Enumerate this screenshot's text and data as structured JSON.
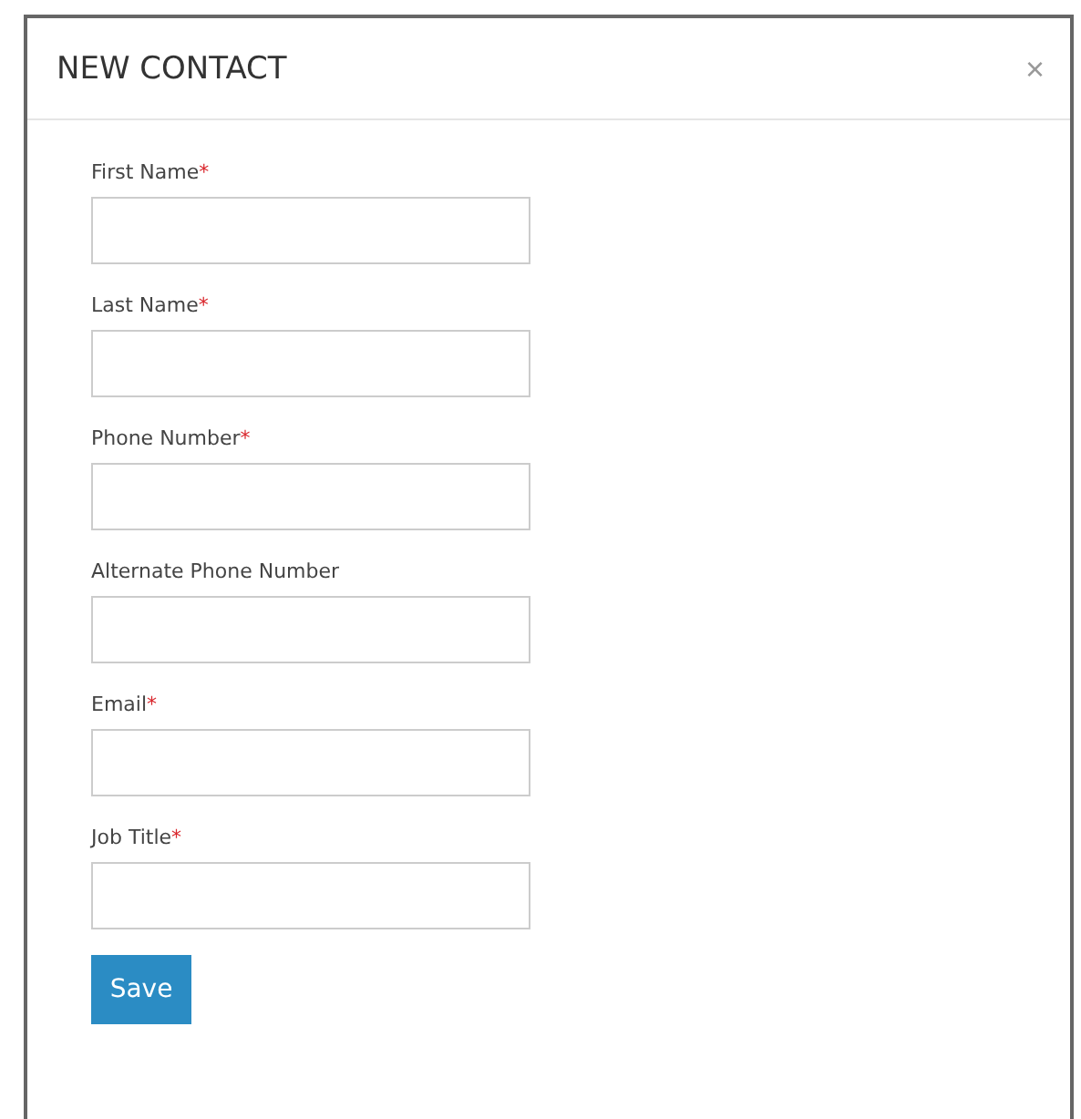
{
  "dialog": {
    "title": "NEW CONTACT",
    "close": "×"
  },
  "fields": [
    {
      "label": "First Name",
      "required_mark": "*"
    },
    {
      "label": "Last Name",
      "required_mark": "*"
    },
    {
      "label": "Phone Number",
      "required_mark": "*"
    },
    {
      "label": "Alternate Phone Number"
    },
    {
      "label": "Email",
      "required_mark": "*"
    },
    {
      "label": "Job Title",
      "required_mark": "*"
    }
  ],
  "buttons": [
    "Save"
  ]
}
